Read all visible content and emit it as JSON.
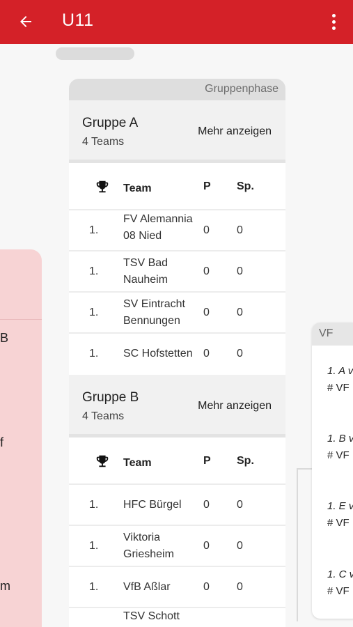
{
  "appbar": {
    "title": "U11",
    "back_icon": "arrow-back-icon",
    "menu_icon": "more-vert-icon",
    "color": "#d42128"
  },
  "left_panel": {
    "fragments": [
      "B",
      "f",
      "m"
    ]
  },
  "main": {
    "phase_label": "Gruppenphase",
    "table_header": {
      "team": "Team",
      "p": "P",
      "sp": "Sp."
    },
    "groups": [
      {
        "name": "Gruppe A",
        "count": "4 Teams",
        "more_label": "Mehr anzeigen",
        "rows": [
          {
            "rank": "1.",
            "team": "FV Alemannia 08 Nied",
            "p": "0",
            "sp": "0"
          },
          {
            "rank": "1.",
            "team": "TSV Bad Nauheim",
            "p": "0",
            "sp": "0"
          },
          {
            "rank": "1.",
            "team": "SV Eintracht Bennungen",
            "p": "0",
            "sp": "0"
          },
          {
            "rank": "1.",
            "team": "SC Hofstetten",
            "p": "0",
            "sp": "0"
          }
        ]
      },
      {
        "name": "Gruppe B",
        "count": "4 Teams",
        "more_label": "Mehr anzeigen",
        "rows": [
          {
            "rank": "1.",
            "team": "HFC Bürgel",
            "p": "0",
            "sp": "0"
          },
          {
            "rank": "1.",
            "team": "Viktoria Griesheim",
            "p": "0",
            "sp": "0"
          },
          {
            "rank": "1.",
            "team": "VfB Aßlar",
            "p": "0",
            "sp": "0"
          },
          {
            "rank": "",
            "team": "TSV Schott",
            "p": "",
            "sp": ""
          }
        ]
      }
    ]
  },
  "right_panel": {
    "header": "VF",
    "matches": [
      {
        "line1": "1. A v",
        "line2": "# VF"
      },
      {
        "line1": "1. B v",
        "line2": "# VF"
      },
      {
        "line1": "1. E v",
        "line2": "# VF"
      },
      {
        "line1": "1. C v",
        "line2": "# VF"
      }
    ]
  }
}
